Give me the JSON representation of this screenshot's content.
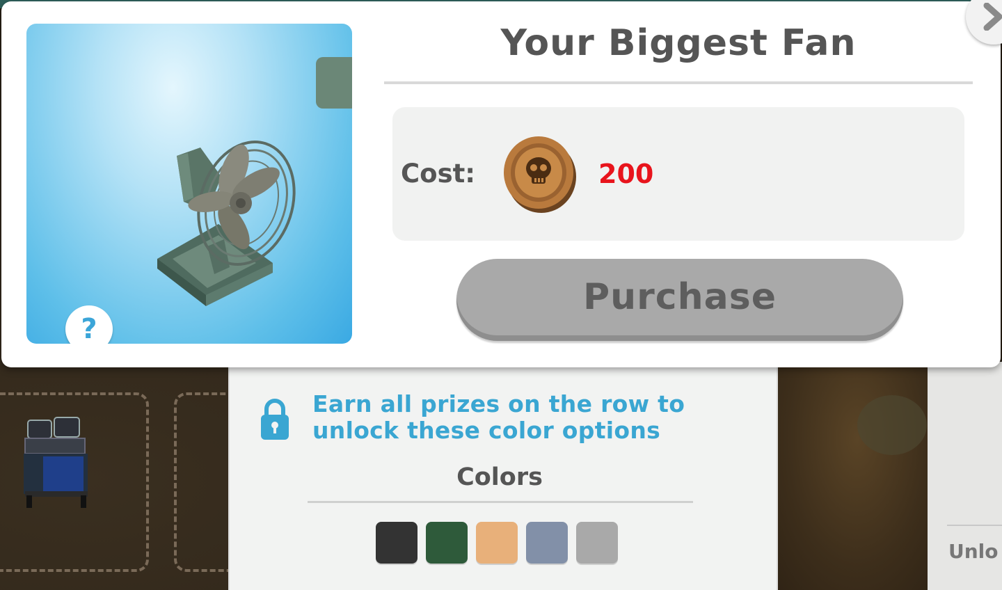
{
  "item": {
    "title": "Your Biggest Fan",
    "preview_icon": "desk-fan",
    "preview_color": "#6b8777"
  },
  "cost": {
    "label": "Cost:",
    "currency_icon": "skull-coin",
    "value": "200",
    "value_color": "#e8141c"
  },
  "purchase": {
    "label": "Purchase",
    "enabled": false
  },
  "help": {
    "label": "?"
  },
  "unlock": {
    "icon": "lock",
    "text": "Earn all prizes on the row to unlock these color options"
  },
  "colors": {
    "title": "Colors",
    "swatches": [
      "#333333",
      "#2e5a3a",
      "#e8b07a",
      "#8290a8",
      "#a9a9a9"
    ]
  },
  "background": {
    "side_label": "Unlo"
  }
}
